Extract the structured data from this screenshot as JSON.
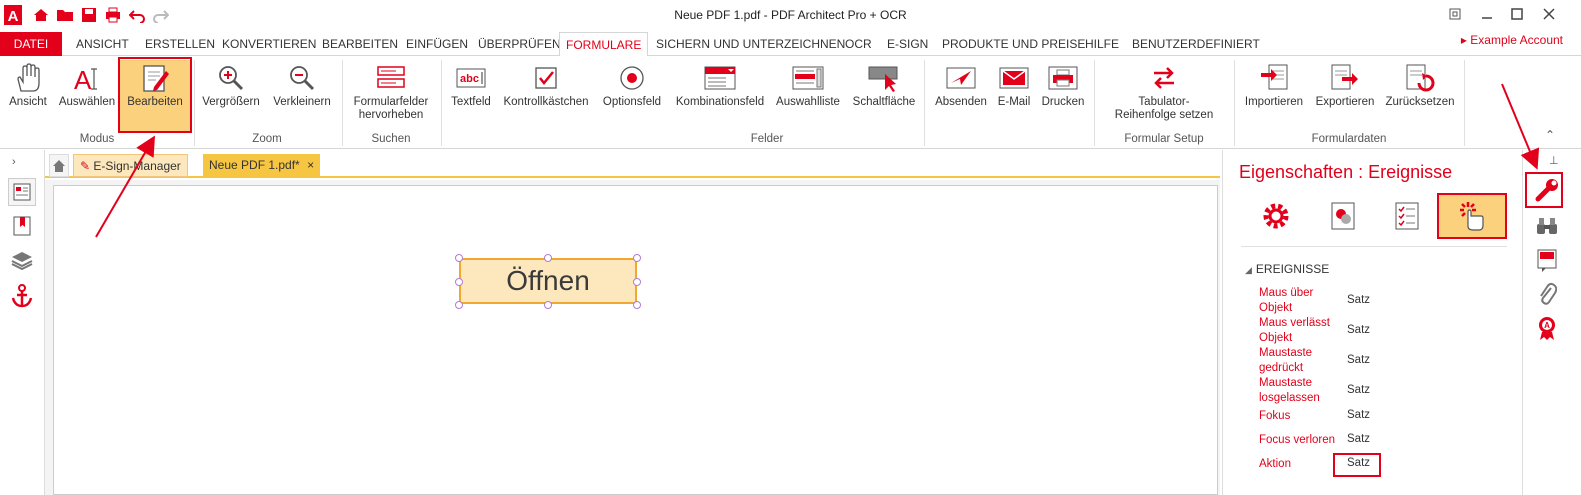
{
  "title_bar": {
    "title": "Neue PDF 1.pdf    -    PDF Architect Pro + OCR",
    "quick_access": [
      "app-logo-icon",
      "home-icon",
      "open-folder-icon",
      "save-icon",
      "print-icon",
      "undo-icon",
      "redo-icon"
    ],
    "window_controls": [
      "restore-small-icon",
      "minimize-icon",
      "maximize-icon",
      "close-icon"
    ]
  },
  "menu": {
    "tabs": [
      "DATEI",
      "ANSICHT",
      "ERSTELLEN",
      "KONVERTIEREN",
      "BEARBEITEN",
      "EINFÜGEN",
      "ÜBERPRÜFEN",
      "FORMULARE",
      "SICHERN UND UNTERZEICHNEN",
      "OCR",
      "E-SIGN",
      "PRODUKTE UND PREISE",
      "HILFE",
      "BENUTZERDEFINIERT"
    ],
    "active": "FORMULARE",
    "account": "Example Account"
  },
  "ribbon": {
    "modus": {
      "label": "Modus",
      "buttons": [
        "Ansicht",
        "Auswählen",
        "Bearbeiten"
      ]
    },
    "zoom": {
      "label": "Zoom",
      "buttons": [
        "Vergrößern",
        "Verkleinern"
      ]
    },
    "suchen": {
      "label": "Suchen",
      "buttons": [
        "Formularfelder hervorheben"
      ]
    },
    "felder": {
      "label": "Felder",
      "buttons": [
        "Textfeld",
        "Kontrollkästchen",
        "Optionsfeld",
        "Kombinationsfeld",
        "Auswahlliste",
        "Schaltfläche",
        "Absenden",
        "E-Mail",
        "Drucken"
      ]
    },
    "setup": {
      "label": "Formular Setup",
      "buttons": [
        "Tabulator-Reihenfolge setzen"
      ]
    },
    "daten": {
      "label": "Formulardaten",
      "buttons": [
        "Importieren",
        "Exportieren",
        "Zurücksetzen"
      ]
    }
  },
  "doc_tabs": {
    "items": [
      "E-Sign-Manager",
      "Neue PDF 1.pdf*"
    ],
    "close_glyph": "×"
  },
  "document": {
    "button_text": "Öffnen"
  },
  "properties": {
    "title": "Eigenschaften : Ereignisse",
    "section": "EREIGNISSE",
    "events": [
      {
        "label": "Maus über Objekt",
        "value": "Satz"
      },
      {
        "label": "Maus verlässt Objekt",
        "value": "Satz"
      },
      {
        "label": "Maustaste gedrückt",
        "value": "Satz"
      },
      {
        "label": "Maustaste losgelassen",
        "value": "Satz"
      },
      {
        "label": "Fokus",
        "value": "Satz"
      },
      {
        "label": "Focus verloren",
        "value": "Satz"
      },
      {
        "label": "Aktion",
        "value": "Satz"
      }
    ]
  },
  "colors": {
    "accent": "#e2001a",
    "highlight": "#fbd17e",
    "tab_underline": "#f6c542"
  }
}
